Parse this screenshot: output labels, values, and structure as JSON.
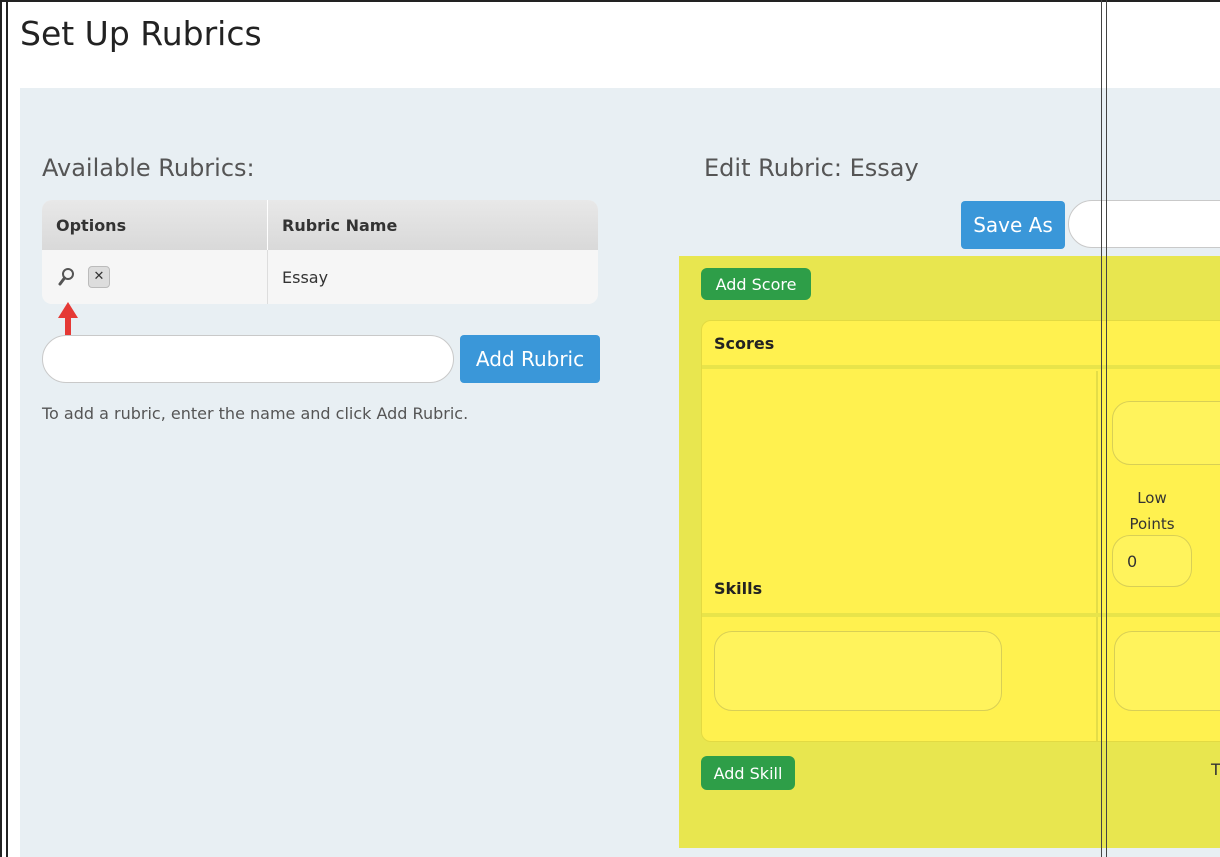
{
  "page": {
    "title": "Set Up Rubrics"
  },
  "available": {
    "heading": "Available Rubrics:",
    "columns": {
      "options": "Options",
      "name": "Rubric Name"
    },
    "rows": [
      {
        "name": "Essay"
      }
    ],
    "add_button": "Add Rubric",
    "hint": "To add a rubric, enter the name and click Add Rubric."
  },
  "edit": {
    "heading": "Edit Rubric: Essay",
    "save_as_button": "Save As",
    "add_score_button": "Add Score",
    "scores_label": "Scores",
    "skills_label": "Skills",
    "low_points_label": "Low Points",
    "low_points_value": "0",
    "add_skill_button": "Add Skill",
    "truncated_text": "T"
  },
  "colors": {
    "accent_blue": "#3a97d9",
    "accent_green": "#2e9e48",
    "yellow_area": "#e8e64f",
    "arrow_red": "#e53935"
  },
  "icons": {
    "view": "magnifier-icon",
    "delete": "close-box-icon",
    "pointer": "arrow-up-icon"
  }
}
